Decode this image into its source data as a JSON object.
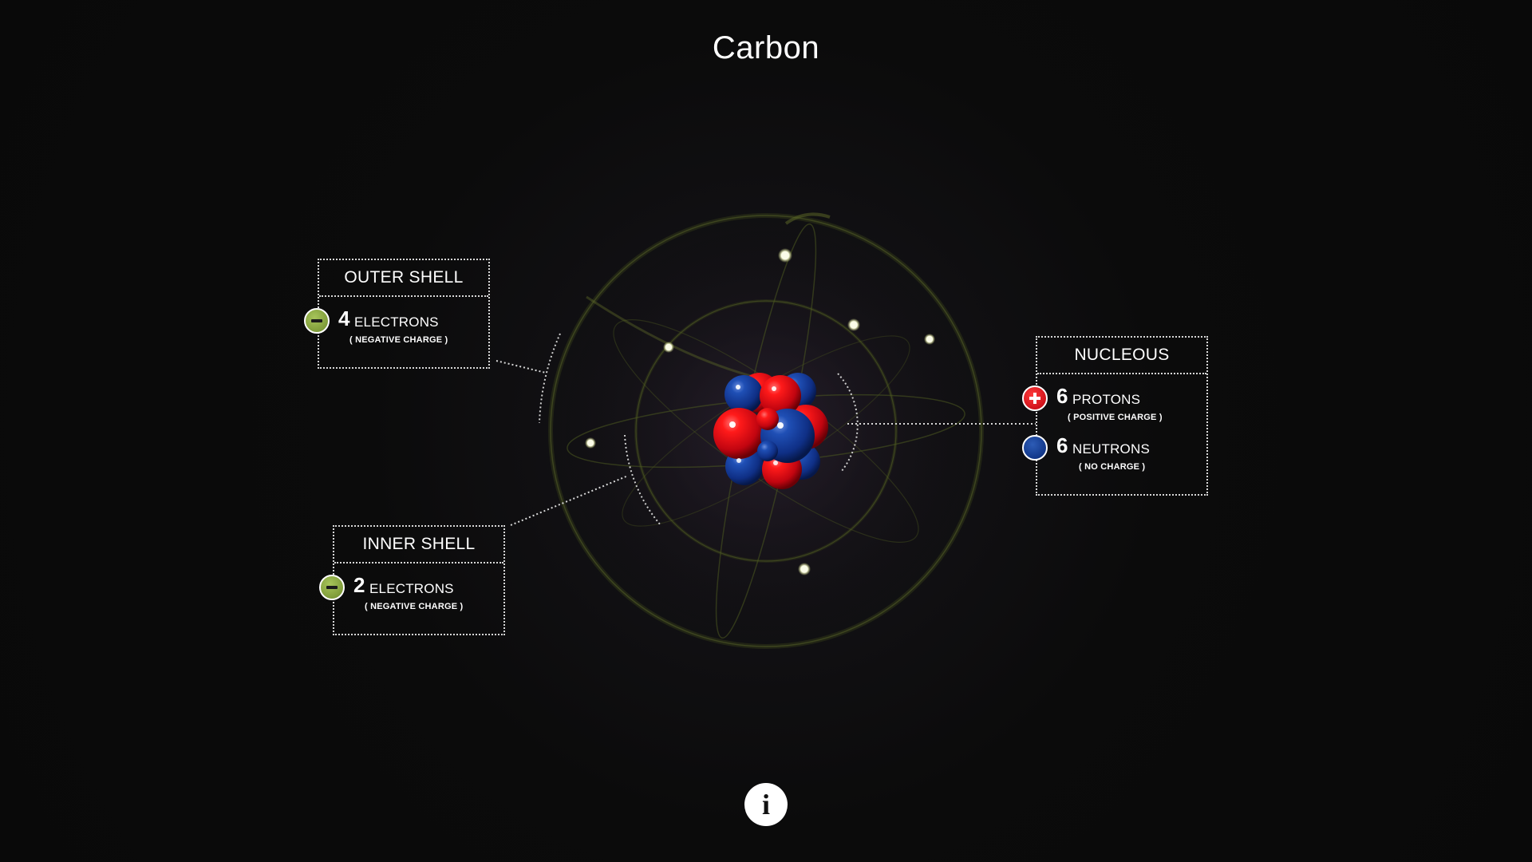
{
  "title": "Carbon",
  "outer_shell": {
    "heading": "OUTER SHELL",
    "count": "4",
    "unit": "ELECTRONS",
    "charge": "( NEGATIVE CHARGE )"
  },
  "inner_shell": {
    "heading": "INNER SHELL",
    "count": "2",
    "unit": "ELECTRONS",
    "charge": "( NEGATIVE CHARGE )"
  },
  "nucleus": {
    "heading": "NUCLEOUS",
    "protons": {
      "count": "6",
      "unit": "PROTONS",
      "charge": "( POSITIVE CHARGE )"
    },
    "neutrons": {
      "count": "6",
      "unit": "NEUTRONS",
      "charge": "( NO CHARGE )"
    }
  },
  "info_button": {
    "label": "i"
  },
  "colors": {
    "proton": "#d0121b",
    "neutron": "#12378a",
    "electron_badge": "#8fae45",
    "electron": "#f4f6d8",
    "orbit": "#3a4020"
  },
  "icons": {
    "electron_badge": "minus-sign-icon",
    "proton_badge": "plus-sign-icon",
    "neutron_badge": "neutral-circle-icon",
    "info": "info-icon"
  }
}
